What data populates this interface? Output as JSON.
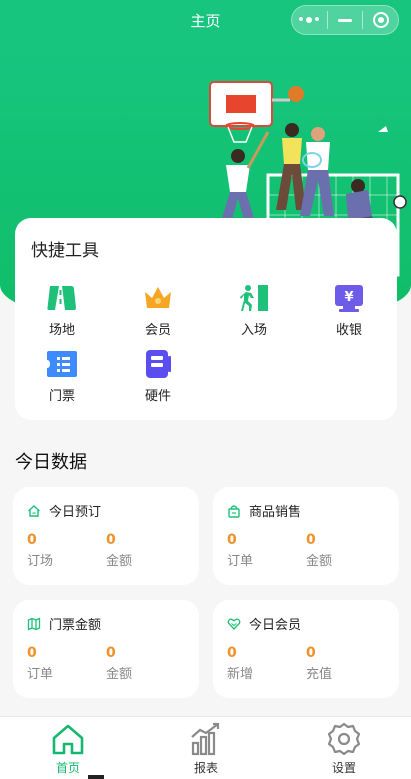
{
  "header": {
    "title": "主页"
  },
  "tools": {
    "title": "快捷工具",
    "items": [
      {
        "label": "场地",
        "icon": "venue-icon"
      },
      {
        "label": "会员",
        "icon": "crown-icon"
      },
      {
        "label": "入场",
        "icon": "entry-icon"
      },
      {
        "label": "收银",
        "icon": "cashier-icon"
      },
      {
        "label": "门票",
        "icon": "ticket-icon"
      },
      {
        "label": "硬件",
        "icon": "hardware-icon"
      }
    ]
  },
  "today": {
    "title": "今日数据",
    "cards": [
      {
        "title": "今日预订",
        "icon": "home-outline-icon",
        "a_value": "0",
        "a_label": "订场",
        "b_value": "0",
        "b_label": "金额"
      },
      {
        "title": "商品销售",
        "icon": "shop-bag-icon",
        "a_value": "0",
        "a_label": "订单",
        "b_value": "0",
        "b_label": "金额"
      },
      {
        "title": "门票金额",
        "icon": "map-icon",
        "a_value": "0",
        "a_label": "订单",
        "b_value": "0",
        "b_label": "金额"
      },
      {
        "title": "今日会员",
        "icon": "heart-icon",
        "a_value": "0",
        "a_label": "新增",
        "b_value": "0",
        "b_label": "充值"
      }
    ]
  },
  "tabbar": {
    "items": [
      {
        "label": "首页",
        "icon": "home-icon",
        "active": true
      },
      {
        "label": "报表",
        "icon": "chart-icon",
        "active": false
      },
      {
        "label": "设置",
        "icon": "settings-icon",
        "active": false
      }
    ]
  },
  "colors": {
    "primary": "#17c57f",
    "accent_number": "#f0922b"
  }
}
